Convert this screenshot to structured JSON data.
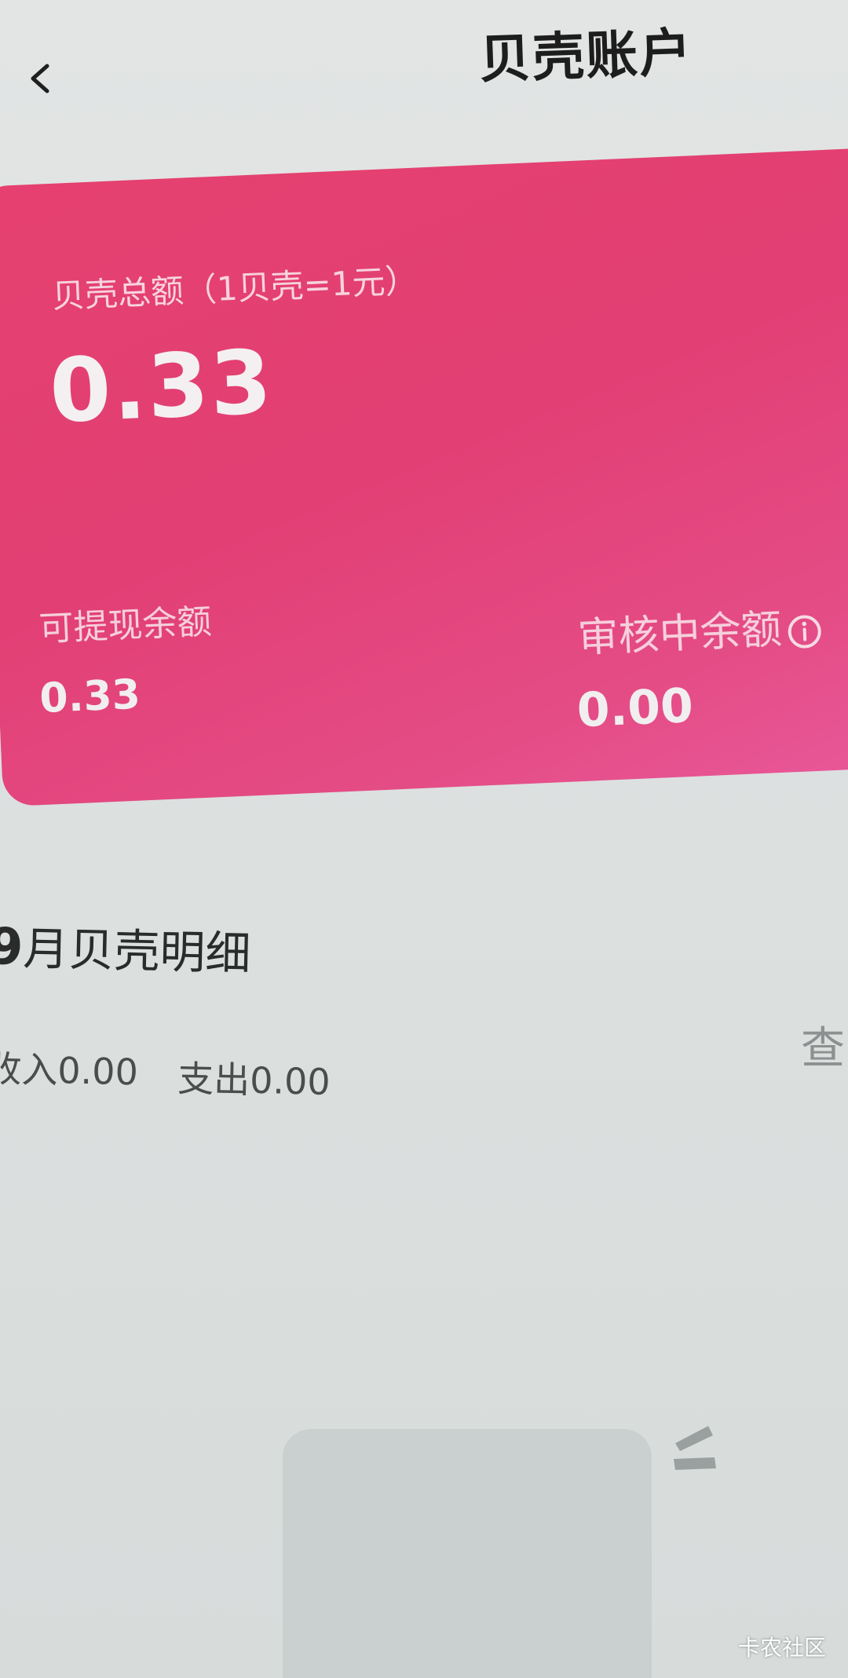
{
  "header": {
    "title": "贝壳账户",
    "back_icon": "chevron-left-icon"
  },
  "balance_card": {
    "total_label": "贝壳总额（1贝壳=1元）",
    "total_value": "0.33",
    "withdrawable_label": "可提现余额",
    "withdrawable_value": "0.33",
    "reviewing_label": "审核中余额",
    "reviewing_value": "0.00",
    "info_icon": "info-circle-icon",
    "colors": {
      "gradient_start": "#e5406f",
      "gradient_end": "#e9589a"
    }
  },
  "monthly": {
    "month": "9",
    "title_suffix": "月贝壳明细",
    "income": "收入0.00",
    "expense": "支出0.00",
    "view_link": "查"
  },
  "watermark": "卡农社区"
}
